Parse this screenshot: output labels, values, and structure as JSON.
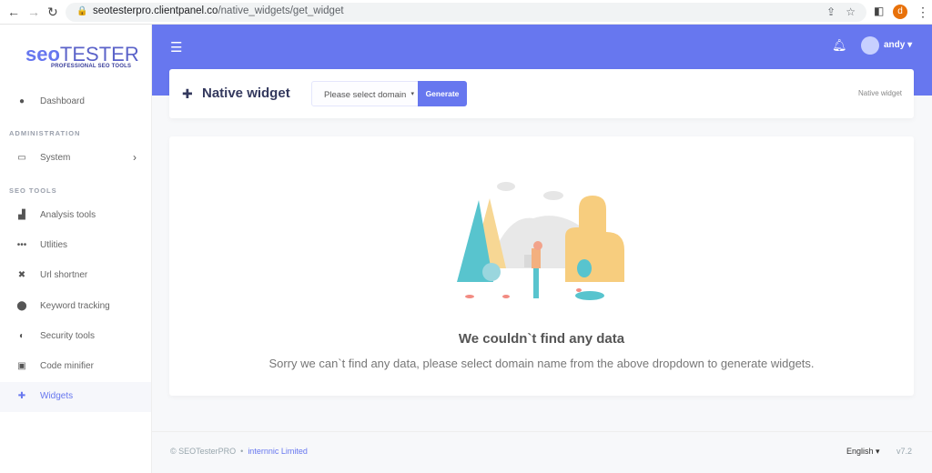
{
  "browser": {
    "url_host": "seotesterpro.clientpanel.co",
    "url_path": "/native_widgets/get_widget",
    "profile_initial": "d"
  },
  "logo": {
    "text_a": "seo",
    "text_b": "TESTER",
    "tagline": "PROFESSIONAL SEO TOOLS"
  },
  "sidebar": {
    "sections": [
      "ADMINISTRATION",
      "SEO TOOLS"
    ],
    "items": [
      {
        "label": "Dashboard",
        "icon": "fire-icon"
      },
      {
        "label": "System",
        "icon": "laptop-icon"
      },
      {
        "label": "Analysis tools",
        "icon": "chart-area-icon"
      },
      {
        "label": "Utlities",
        "icon": "ellipsis-icon"
      },
      {
        "label": "Url shortner",
        "icon": "compress-icon"
      },
      {
        "label": "Keyword tracking",
        "icon": "map-marker-icon"
      },
      {
        "label": "Security tools",
        "icon": "shield-icon"
      },
      {
        "label": "Code minifier",
        "icon": "code-icon"
      },
      {
        "label": "Widgets",
        "icon": "puzzle-icon",
        "active": true
      }
    ]
  },
  "header": {
    "user": "andy"
  },
  "page": {
    "title": "Native widget",
    "select_placeholder": "Please select domain",
    "generate": "Generate",
    "breadcrumb": "Native widget"
  },
  "empty": {
    "title": "We couldn`t find any data",
    "message": "Sorry we can`t find any data, please select domain name from the above dropdown to generate widgets."
  },
  "footer": {
    "copyright": "© SEOTesterPRO",
    "company": "internnic Limited",
    "language": "English",
    "version": "v7.2"
  },
  "colors": {
    "primary": "#6777ef",
    "text_dark": "#34395e"
  }
}
